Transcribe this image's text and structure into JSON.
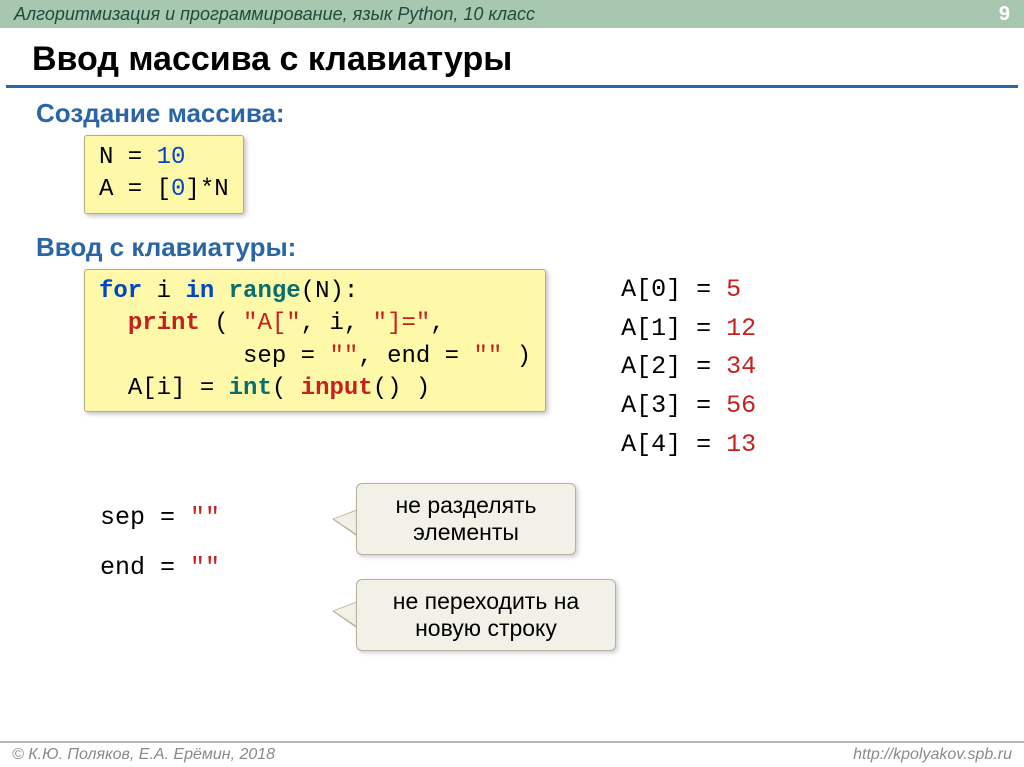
{
  "header": {
    "course": "Алгоритмизация и программирование, язык Python, 10 класс",
    "page": "9"
  },
  "title": "Ввод массива с клавиатуры",
  "section1": {
    "heading": "Создание массива:",
    "line1_left": "N = ",
    "line1_num": "10",
    "line2_left": "A = [",
    "line2_zero": "0",
    "line2_right": "]*N"
  },
  "section2": {
    "heading": "Ввод с клавиатуры:",
    "c2": {
      "for": "for",
      "i": " i ",
      "in": "in",
      "sp": " ",
      "range": "range",
      "l1tail": "(N):",
      "print": "print",
      "l2a": " ( ",
      "s1": "\"A[\"",
      "c1": ", i, ",
      "s2": "\"]=\"",
      "c2": ",",
      "l3a": "sep = ",
      "s3": "\"\"",
      "l3b": ", end = ",
      "s4": "\"\"",
      "l3c": " )",
      "l4a": "A[i] = ",
      "int": "int",
      "l4b": "( ",
      "input": "input",
      "l4c": "() )"
    }
  },
  "output": [
    {
      "k": "A[0] = ",
      "v": "5"
    },
    {
      "k": "A[1] = ",
      "v": "12"
    },
    {
      "k": "A[2] = ",
      "v": "34"
    },
    {
      "k": "A[3] = ",
      "v": "56"
    },
    {
      "k": "A[4] = ",
      "v": "13"
    }
  ],
  "callouts": {
    "label1a": "sep = ",
    "label1b": "\"\"",
    "label2a": "end = ",
    "label2b": "\"\"",
    "bubble1a": "не разделять",
    "bubble1b": "элементы",
    "bubble2a": "не переходить на",
    "bubble2b": "новую строку"
  },
  "footer": {
    "left": "© К.Ю. Поляков, Е.А. Ерёмин, 2018",
    "right": "http://kpolyakov.spb.ru"
  }
}
